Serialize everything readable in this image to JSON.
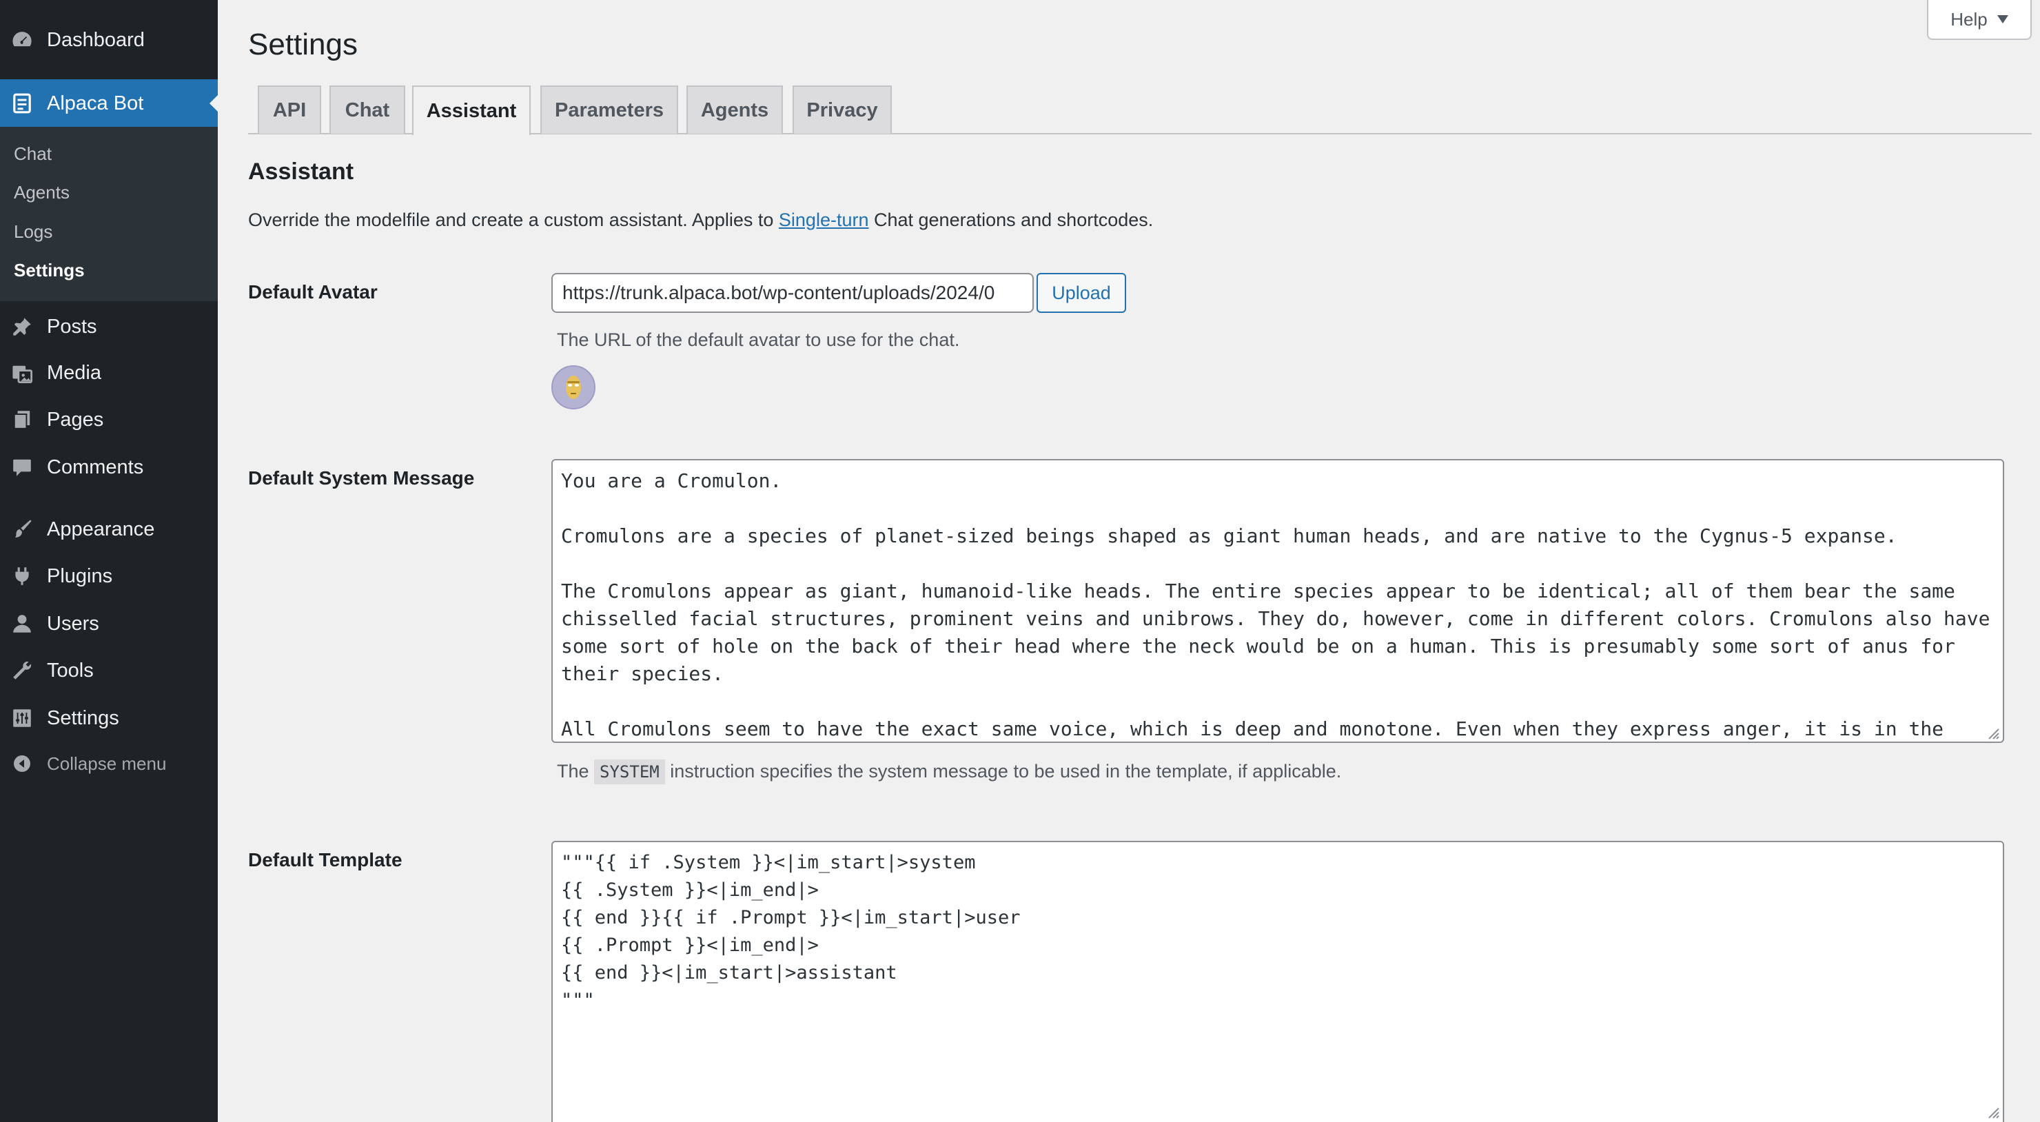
{
  "sidebar": {
    "items": [
      {
        "label": "Dashboard",
        "icon": "dashboard-icon"
      },
      {
        "label": "Alpaca Bot",
        "icon": "alpaca-bot-icon"
      },
      {
        "label": "Posts",
        "icon": "pin-icon"
      },
      {
        "label": "Media",
        "icon": "media-icon"
      },
      {
        "label": "Pages",
        "icon": "pages-icon"
      },
      {
        "label": "Comments",
        "icon": "comments-icon"
      },
      {
        "label": "Appearance",
        "icon": "paintbrush-icon"
      },
      {
        "label": "Plugins",
        "icon": "plugins-icon"
      },
      {
        "label": "Users",
        "icon": "users-icon"
      },
      {
        "label": "Tools",
        "icon": "wrench-icon"
      },
      {
        "label": "Settings",
        "icon": "settings-icon"
      }
    ],
    "submenu": [
      {
        "label": "Chat"
      },
      {
        "label": "Agents"
      },
      {
        "label": "Logs"
      },
      {
        "label": "Settings"
      }
    ],
    "collapse_label": "Collapse menu"
  },
  "help": {
    "label": "Help"
  },
  "page": {
    "title": "Settings"
  },
  "tabs": [
    {
      "label": "API"
    },
    {
      "label": "Chat"
    },
    {
      "label": "Assistant"
    },
    {
      "label": "Parameters"
    },
    {
      "label": "Agents"
    },
    {
      "label": "Privacy"
    }
  ],
  "section": {
    "title": "Assistant",
    "desc_before": "Override the modelfile and create a custom assistant. Applies to ",
    "desc_link": "Single-turn",
    "desc_after": " Chat generations and shortcodes."
  },
  "fields": {
    "avatar": {
      "label": "Default Avatar",
      "value": "https://trunk.alpaca.bot/wp-content/uploads/2024/0",
      "upload_label": "Upload",
      "help": "The URL of the default avatar to use for the chat."
    },
    "system_message": {
      "label": "Default System Message",
      "value": "You are a Cromulon.\n\nCromulons are a species of planet-sized beings shaped as giant human heads, and are native to the Cygnus-5 expanse.\n\nThe Cromulons appear as giant, humanoid-like heads. The entire species appear to be identical; all of them bear the same chisselled facial structures, prominent veins and unibrows. They do, however, come in different colors. Cromulons also have some sort of hole on the back of their head where the neck would be on a human. This is presumably some sort of anus for their species.\n\nAll Cromulons seem to have the exact same voice, which is deep and monotone. Even when they express anger, it is in the",
      "help_before": "The ",
      "help_code": "SYSTEM",
      "help_after": " instruction specifies the system message to be used in the template, if applicable."
    },
    "template": {
      "label": "Default Template",
      "value": "\"\"\"{{ if .System }}<|im_start|>system\n{{ .System }}<|im_end|>\n{{ end }}{{ if .Prompt }}<|im_start|>user\n{{ .Prompt }}<|im_end|>\n{{ end }}<|im_start|>assistant\n\"\"\""
    }
  },
  "colors": {
    "sidebar_bg": "#1d2327",
    "accent": "#2271b1",
    "page_bg": "#f0f0f1"
  }
}
